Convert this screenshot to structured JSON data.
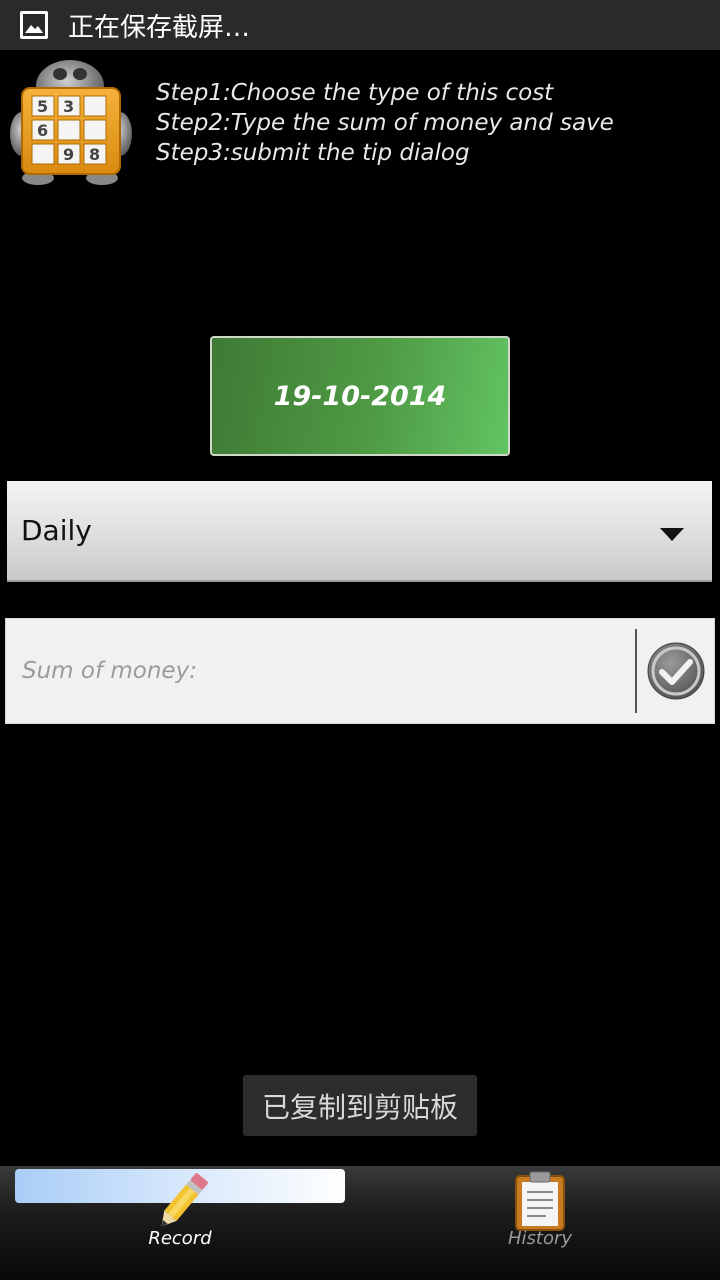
{
  "status_bar": {
    "text": "正在保存截屏…",
    "icon": "image-icon"
  },
  "header": {
    "app_icon": "sudoku-robot-icon",
    "steps": [
      "Step1:Choose the type of this cost",
      "Step2:Type the sum of money and save",
      "Step3:submit the tip dialog"
    ]
  },
  "date_button": {
    "label": "19-10-2014",
    "color": "#4f9a45"
  },
  "type_spinner": {
    "selected": "Daily",
    "icon": "dropdown-arrow-icon"
  },
  "money_input": {
    "placeholder": "Sum of money:",
    "value": "",
    "submit_icon": "check-icon"
  },
  "toast": {
    "text": "已复制到剪贴板"
  },
  "tabs": [
    {
      "label": "Record",
      "icon": "pencil-icon",
      "active": true
    },
    {
      "label": "History",
      "icon": "clipboard-icon",
      "active": false
    }
  ]
}
